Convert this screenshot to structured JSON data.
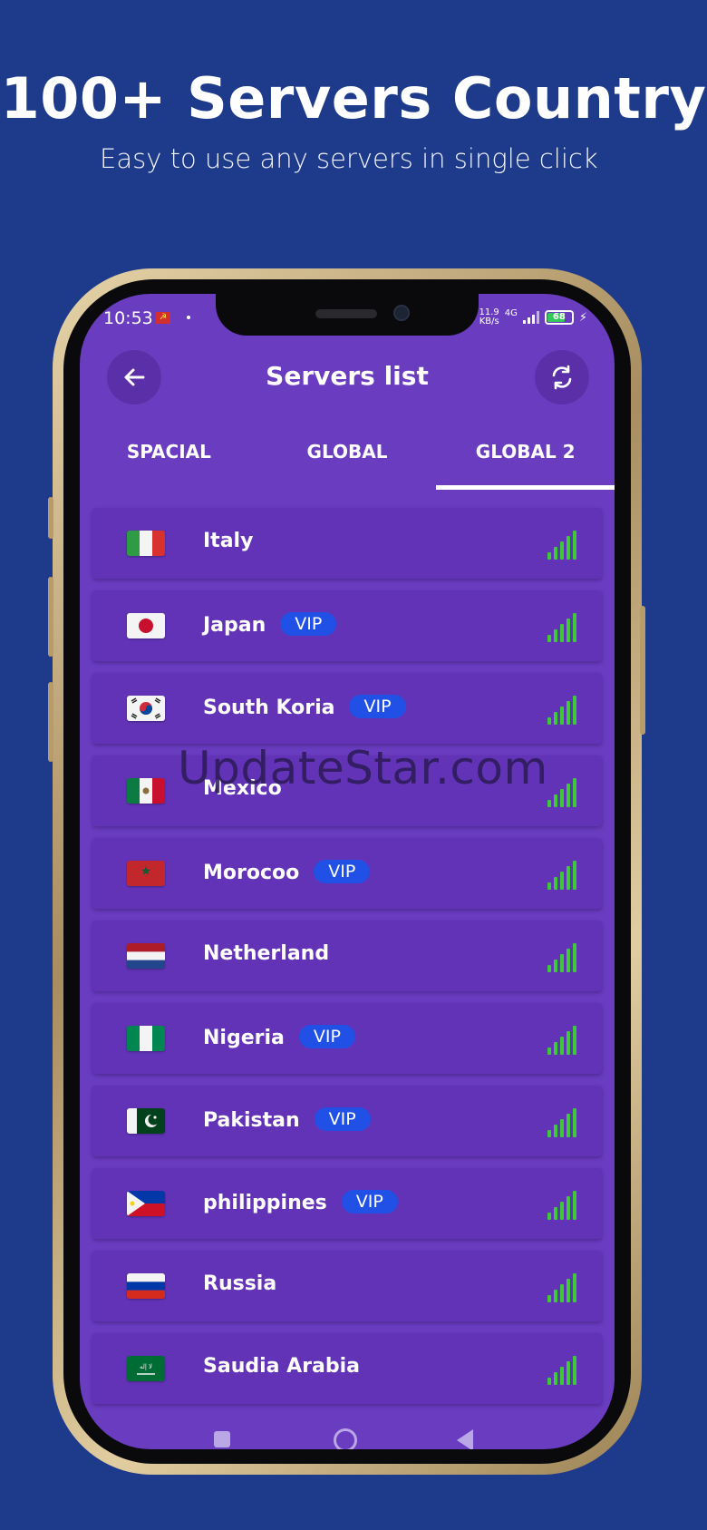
{
  "promo": {
    "title": "100+ Servers Country",
    "subtitle": "Easy to use any servers in single click"
  },
  "status_bar": {
    "time": "10:53",
    "net_speed_value": "11.9",
    "net_speed_unit": "KB/s",
    "network": "4G",
    "battery": "68"
  },
  "header": {
    "title": "Servers list",
    "back_icon": "arrow-left-icon",
    "refresh_icon": "refresh-icon"
  },
  "tabs": [
    {
      "label": "SPACIAL",
      "active": false
    },
    {
      "label": "GLOBAL",
      "active": false
    },
    {
      "label": "GLOBAL 2",
      "active": true
    }
  ],
  "servers": [
    {
      "name": "Italy",
      "vip": "",
      "flag": "italy-flag-icon"
    },
    {
      "name": "Japan",
      "vip": "VIP",
      "flag": "japan-flag-icon"
    },
    {
      "name": "South Koria",
      "vip": "VIP",
      "flag": "south-korea-flag-icon"
    },
    {
      "name": "Mexico",
      "vip": "",
      "flag": "mexico-flag-icon"
    },
    {
      "name": "Morocoo",
      "vip": "VIP",
      "flag": "morocco-flag-icon"
    },
    {
      "name": "Netherland",
      "vip": "",
      "flag": "netherlands-flag-icon"
    },
    {
      "name": "Nigeria",
      "vip": "VIP",
      "flag": "nigeria-flag-icon"
    },
    {
      "name": "Pakistan",
      "vip": "VIP",
      "flag": "pakistan-flag-icon"
    },
    {
      "name": "philippines",
      "vip": "VIP",
      "flag": "philippines-flag-icon"
    },
    {
      "name": "Russia",
      "vip": "",
      "flag": "russia-flag-icon"
    },
    {
      "name": "Saudia Arabia",
      "vip": "",
      "flag": "saudi-arabia-flag-icon"
    }
  ],
  "watermark": "UpdateStar.com",
  "colors": {
    "background": "#1e3a8a",
    "screen": "#6a3cc0",
    "row": "#6233b7",
    "vip_badge": "#2150e6",
    "signal": "#3ec93b"
  }
}
